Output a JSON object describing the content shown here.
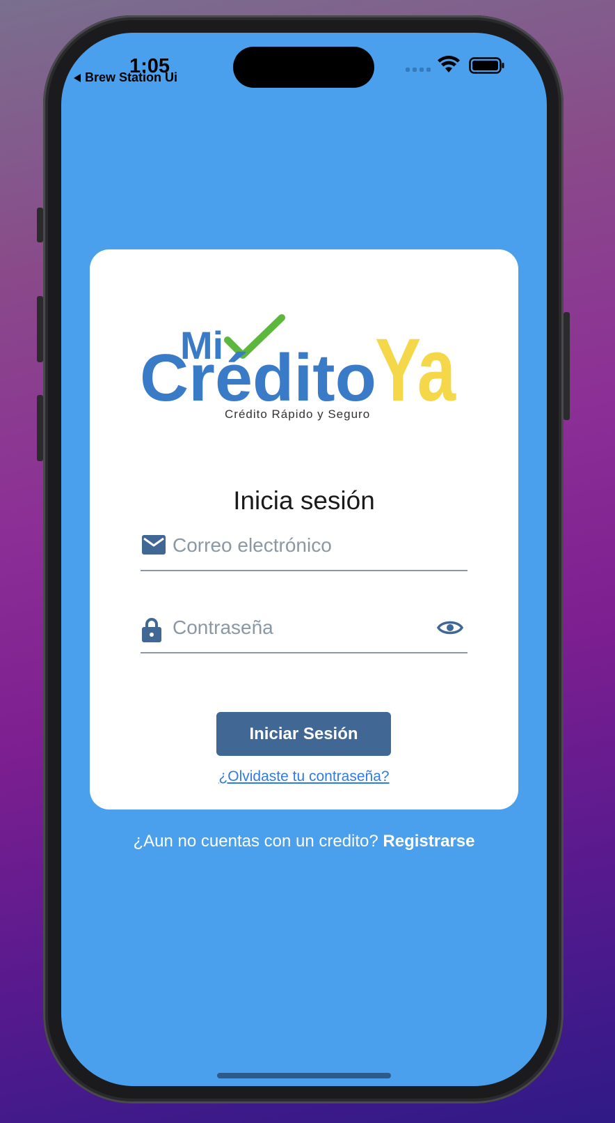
{
  "status_bar": {
    "time": "1:05",
    "back_app": "Brew Station Ui"
  },
  "logo": {
    "mi": "Mi",
    "credito": "Crédito",
    "ya": "Ya",
    "tagline": "Crédito Rápido y Seguro"
  },
  "login": {
    "heading": "Inicia sesión",
    "email_placeholder": "Correo electrónico",
    "password_placeholder": "Contraseña",
    "submit_label": "Iniciar Sesión",
    "forgot_label": "¿Olvidaste tu contraseña?"
  },
  "footer": {
    "prompt": "¿Aun no cuentas con un credito?",
    "register_label": "Registrarse"
  },
  "colors": {
    "screen_bg": "#4aa0ec",
    "button": "#416795",
    "logo_blue": "#3a7bc8",
    "logo_yellow": "#f5d84a",
    "logo_green": "#5cb83c",
    "link": "#2f7be6"
  },
  "icons": {
    "email": "mail-icon",
    "password": "lock-icon",
    "toggle": "eye-icon"
  }
}
